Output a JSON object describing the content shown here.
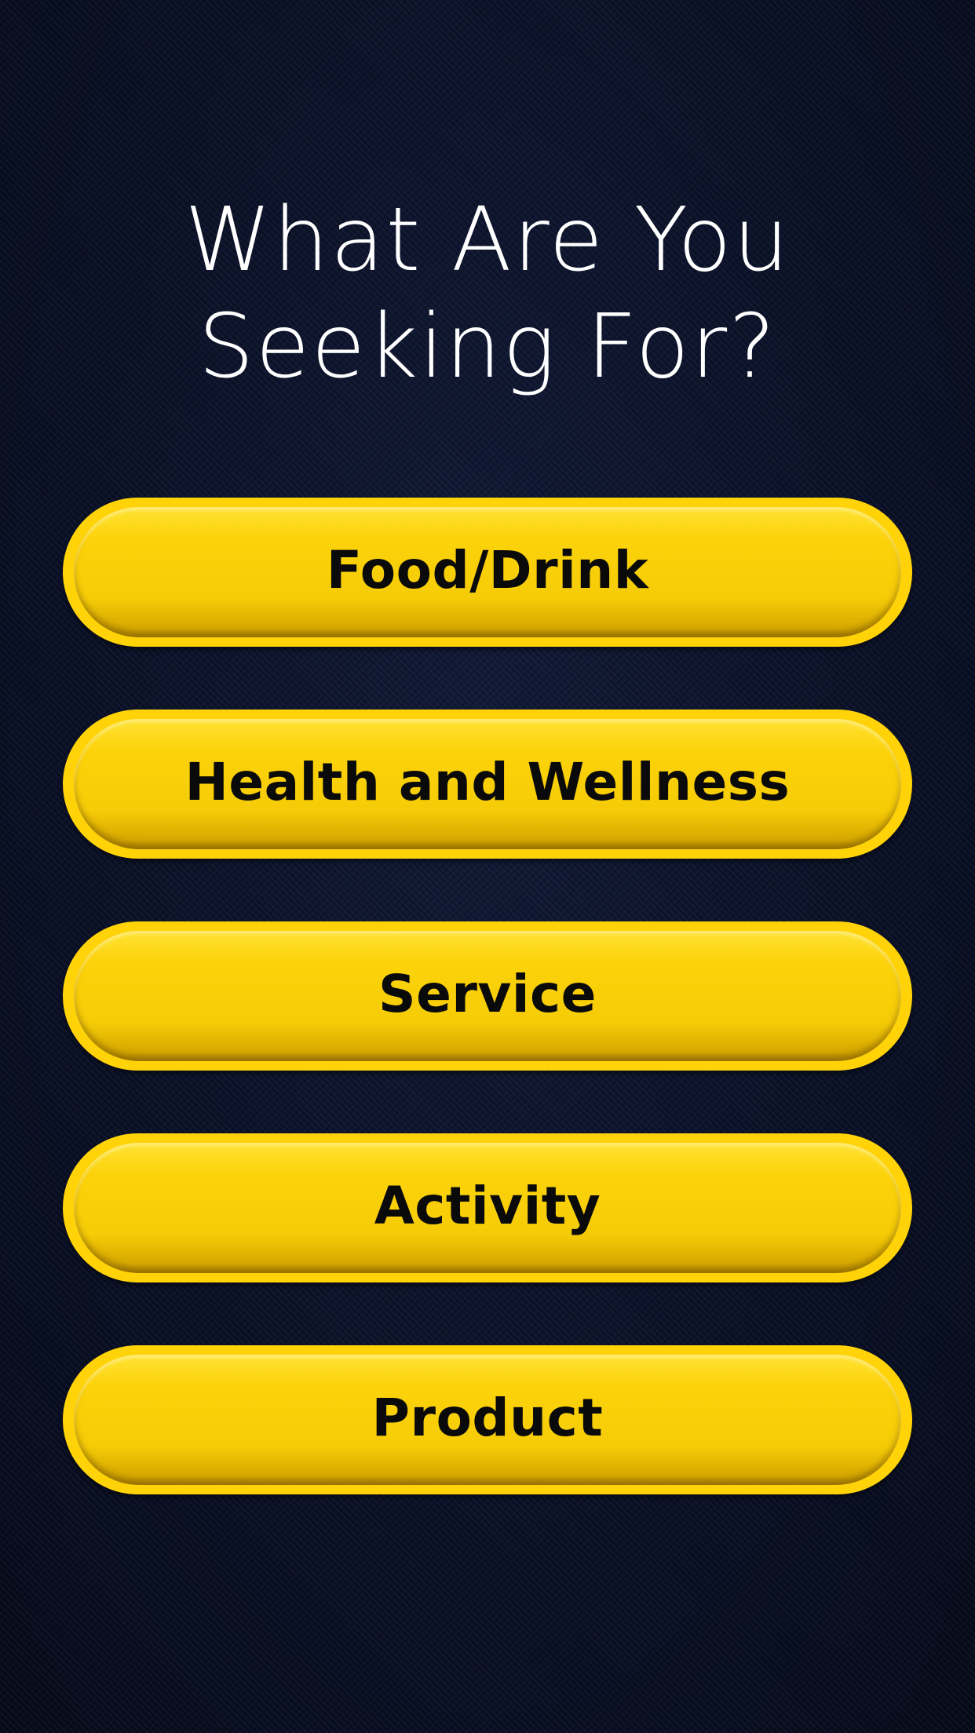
{
  "title": {
    "line1": "What Are You",
    "line2": "Seeking For?"
  },
  "options": [
    {
      "label": "Food/Drink"
    },
    {
      "label": "Health and Wellness"
    },
    {
      "label": "Service"
    },
    {
      "label": "Activity"
    },
    {
      "label": "Product"
    }
  ],
  "colors": {
    "background": "#0b1228",
    "button": "#ffd308",
    "button_text": "#0a0a0a",
    "title_text": "#ffffff"
  }
}
